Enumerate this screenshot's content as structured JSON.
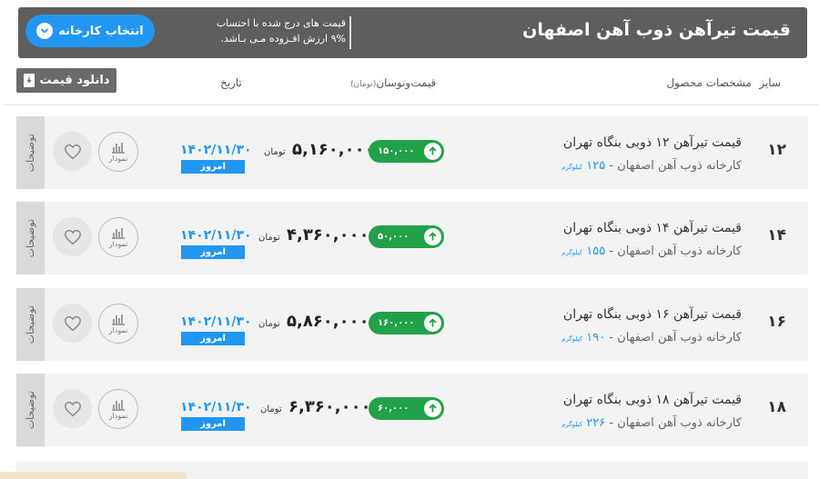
{
  "header": {
    "title": "قیمت تیرآهن ذوب آهن اصفهان",
    "note_line1": "قیمت های درج شده با احتساب",
    "note_line2": "۹% ارزش افـزوده مـی بـاشد.",
    "factory_button": "انتخاب کارخانه"
  },
  "toolbar": {
    "download_label": "دانلود قیمت"
  },
  "columns": {
    "size": "سایز",
    "specs": "مشخصات محصول",
    "price": "قیمت‌ونوسان",
    "price_unit": "(تومان)",
    "date": "تاریخ"
  },
  "rows": [
    {
      "size": "۱۲",
      "name": "قیمت تیرآهن ۱۲ ذوبی بنگاه تهران",
      "factory": "کارخانه ذوب آهن اصفهان - ",
      "weight": "۱۲۵",
      "weight_unit": "کیلوگرم",
      "change": "۱۵۰,۰۰۰",
      "price": "۵,۱۶۰,۰۰۰",
      "currency": "تومان",
      "date": "۱۴۰۲/۱۱/۳۰",
      "today": "امروز",
      "chart_label": "نمودار",
      "side_label": "توضیحات"
    },
    {
      "size": "۱۴",
      "name": "قیمت تیرآهن ۱۴ ذوبی بنگاه تهران",
      "factory": "کارخانه ذوب آهن اصفهان - ",
      "weight": "۱۵۵",
      "weight_unit": "کیلوگرم",
      "change": "۵۰,۰۰۰",
      "price": "۴,۳۶۰,۰۰۰",
      "currency": "تومان",
      "date": "۱۴۰۲/۱۱/۳۰",
      "today": "امروز",
      "chart_label": "نمودار",
      "side_label": "توضیحات"
    },
    {
      "size": "۱۶",
      "name": "قیمت تیرآهن ۱۶ ذوبی بنگاه تهران",
      "factory": "کارخانه ذوب آهن اصفهان - ",
      "weight": "۱۹۰",
      "weight_unit": "کیلوگرم",
      "change": "۱۶۰,۰۰۰",
      "price": "۵,۸۶۰,۰۰۰",
      "currency": "تومان",
      "date": "۱۴۰۲/۱۱/۳۰",
      "today": "امروز",
      "chart_label": "نمودار",
      "side_label": "توضیحات"
    },
    {
      "size": "۱۸",
      "name": "قیمت تیرآهن ۱۸ ذوبی بنگاه تهران",
      "factory": "کارخانه ذوب آهن اصفهان - ",
      "weight": "۲۲۶",
      "weight_unit": "کیلوگرم",
      "change": "۶۰,۰۰۰",
      "price": "۶,۳۶۰,۰۰۰",
      "currency": "تومان",
      "date": "۱۴۰۲/۱۱/۳۰",
      "today": "امروز",
      "chart_label": "نمودار",
      "side_label": "توضیحات"
    }
  ],
  "colors": {
    "header_bg": "#5e5e5e",
    "accent_blue": "#2196f3",
    "up_green": "#21a248",
    "row_bg": "#f3f3f3"
  },
  "icons": {
    "factory_button": "chevron-down-icon",
    "download": "document-download-icon",
    "favorite": "heart-icon",
    "chart": "bar-chart-icon",
    "change": "arrow-up-icon"
  }
}
